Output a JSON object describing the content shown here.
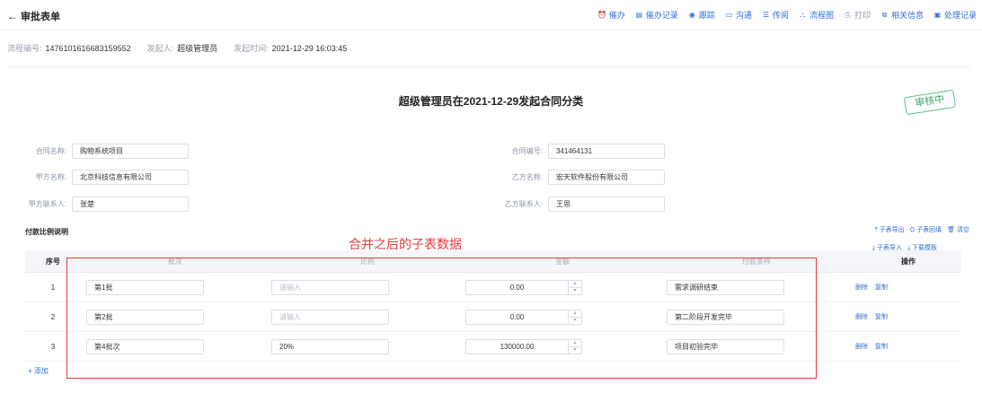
{
  "header": {
    "back_label": "审批表单",
    "actions": [
      {
        "label": "催办",
        "icon": "bell-icon",
        "glyph": "⏰"
      },
      {
        "label": "催办记录",
        "icon": "record-icon",
        "glyph": "▤"
      },
      {
        "label": "跟踪",
        "icon": "track-icon",
        "glyph": "◉"
      },
      {
        "label": "沟通",
        "icon": "chat-icon",
        "glyph": "▭"
      },
      {
        "label": "传阅",
        "icon": "circulate-icon",
        "glyph": "☰"
      },
      {
        "label": "流程图",
        "icon": "flowchart-icon",
        "glyph": "⛬"
      },
      {
        "label": "打印",
        "icon": "print-icon",
        "glyph": "⎙"
      },
      {
        "label": "相关信息",
        "icon": "related-info-icon",
        "glyph": "⧉"
      },
      {
        "label": "处理记录",
        "icon": "history-icon",
        "glyph": "▣"
      }
    ]
  },
  "meta": {
    "flow_no_label": "流程编号:",
    "flow_no": "1476101616683159552",
    "initiator_label": "发起人:",
    "initiator": "超级管理员",
    "time_label": "发起时间:",
    "time": "2021-12-29 16:03:45"
  },
  "form": {
    "title": "超级管理员在2021-12-29发起合同分类",
    "stamp": "审核中",
    "fields": {
      "contract_name_label": "合同名称:",
      "contract_name": "购物系统项目",
      "contract_no_label": "合同编号:",
      "contract_no": "341464131",
      "party_a_label": "甲方名称:",
      "party_a": "北京科技信息有限公司",
      "party_b_label": "乙方名称:",
      "party_b": "宏天软件股份有限公司",
      "party_a_contact_label": "甲方联系人:",
      "party_a_contact": "张楚",
      "party_b_contact_label": "乙方联系人:",
      "party_b_contact": "王思"
    }
  },
  "subtable": {
    "section_title": "付款比例说明",
    "annotation": "合并之后的子表数据",
    "tools_top": [
      "子表导出",
      "子表回填",
      "清空"
    ],
    "tools_bottom": [
      "子表导入",
      "下载模板"
    ],
    "columns": [
      "序号",
      "批次",
      "比例",
      "金额",
      "付款条件",
      "操作"
    ],
    "rows": [
      {
        "seq": "1",
        "batch": "第1批",
        "ratio": "",
        "ratio_placeholder": "请输入",
        "amount": "0.00",
        "condition": "需求调研结束"
      },
      {
        "seq": "2",
        "batch": "第2批",
        "ratio": "",
        "ratio_placeholder": "请输入",
        "amount": "0.00",
        "condition": "第二阶段开发完毕"
      },
      {
        "seq": "3",
        "batch": "第4批次",
        "ratio": "20%",
        "ratio_placeholder": "请输入",
        "amount": "130000.00",
        "condition": "项目初验完毕"
      }
    ],
    "row_actions": [
      "删除",
      "复制"
    ],
    "add_label": "+ 添加"
  }
}
